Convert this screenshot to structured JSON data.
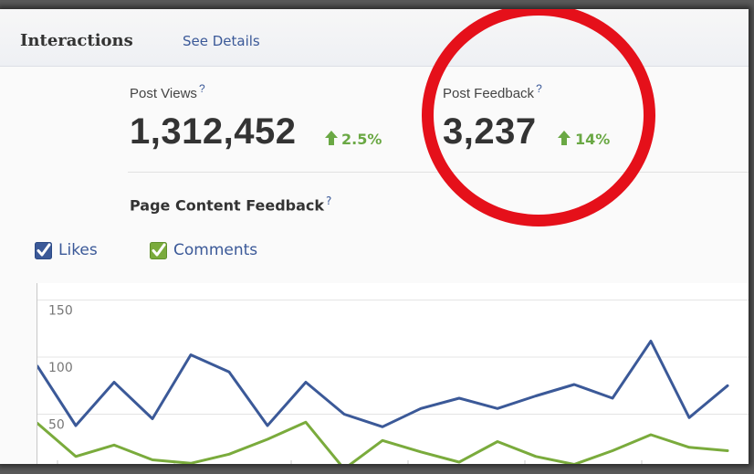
{
  "header": {
    "title": "Interactions",
    "link": "See Details"
  },
  "stats": [
    {
      "label": "Post Views",
      "help": "?",
      "value": "1,312,452",
      "change": "2.5%"
    },
    {
      "label": "Post Feedback",
      "help": "?",
      "value": "3,237",
      "change": "14%"
    }
  ],
  "section": {
    "title": "Page Content Feedback",
    "help": "?"
  },
  "legend": [
    {
      "label": "Likes",
      "checked": true,
      "color": "#3b5998"
    },
    {
      "label": "Comments",
      "checked": true,
      "color": "#6aa844"
    }
  ],
  "colors": {
    "accent": "#3b5998",
    "positive": "#6aa844",
    "highlight": "#e5101a"
  },
  "chart_data": {
    "type": "line",
    "y_ticks": [
      "150",
      "100",
      "50"
    ],
    "ylim": [
      0,
      160
    ],
    "grid": true,
    "series": [
      {
        "name": "Likes",
        "color": "#3b5998",
        "values": [
          92,
          40,
          78,
          46,
          102,
          87,
          40,
          78,
          50,
          39,
          55,
          64,
          55,
          66,
          76,
          64,
          114,
          47,
          75
        ]
      },
      {
        "name": "Comments",
        "color": "#7aab3c",
        "values": [
          42,
          13,
          23,
          10,
          7,
          15,
          28,
          43,
          2,
          27,
          17,
          8,
          26,
          13,
          6,
          18,
          32,
          21,
          18
        ]
      }
    ]
  }
}
